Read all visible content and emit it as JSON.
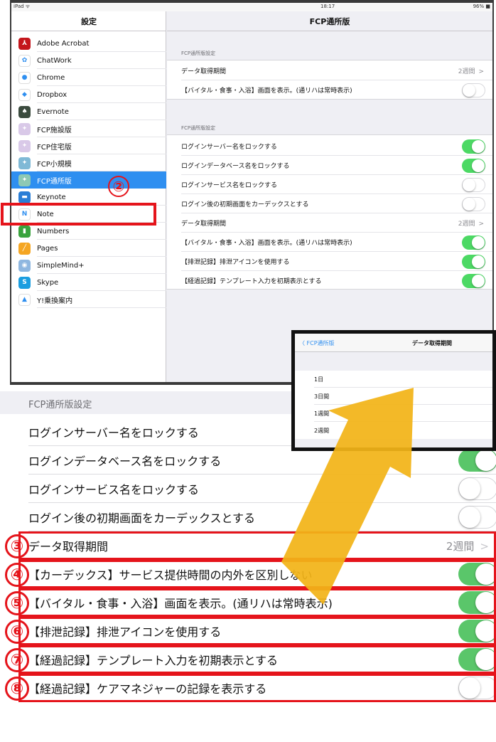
{
  "colors": {
    "accent": "#2f8ff0",
    "toggle_on": "#4cd964",
    "annotation_red": "#e5141b",
    "arrow": "#f2b418"
  },
  "status_bar": {
    "left": "iPad ᯤ",
    "time": "18:17",
    "battery": "96% ■"
  },
  "sidebar": {
    "title": "設定",
    "items": [
      {
        "label": "Adobe Acrobat",
        "icon": "acrobat-icon",
        "glyph": "⅄",
        "color": "#c4161c"
      },
      {
        "label": "ChatWork",
        "icon": "chatwork-icon",
        "glyph": "✿",
        "color": "#ffffff"
      },
      {
        "label": "Chrome",
        "icon": "chrome-icon",
        "glyph": "●",
        "color": "#ffffff"
      },
      {
        "label": "Dropbox",
        "icon": "dropbox-icon",
        "glyph": "◆",
        "color": "#ffffff"
      },
      {
        "label": "Evernote",
        "icon": "evernote-icon",
        "glyph": "♠",
        "color": "#3b4b3e"
      },
      {
        "label": "FCP施設版",
        "icon": "fcp-facility-icon",
        "glyph": "✦",
        "color": "#d9c9e8"
      },
      {
        "label": "FCP住宅版",
        "icon": "fcp-housing-icon",
        "glyph": "✦",
        "color": "#d9c9e8"
      },
      {
        "label": "FCP小規模",
        "icon": "fcp-small-icon",
        "glyph": "✦",
        "color": "#7fb9d6"
      },
      {
        "label": "FCP通所版",
        "icon": "fcp-daycare-icon",
        "glyph": "✦",
        "color": "#8dc9b4"
      },
      {
        "label": "Keynote",
        "icon": "keynote-icon",
        "glyph": "▬",
        "color": "#2a7ed6"
      },
      {
        "label": "Note",
        "icon": "note-icon",
        "glyph": "N",
        "color": "#ffffff"
      },
      {
        "label": "Numbers",
        "icon": "numbers-icon",
        "glyph": "▮",
        "color": "#3aa33d"
      },
      {
        "label": "Pages",
        "icon": "pages-icon",
        "glyph": "╱",
        "color": "#f5a623"
      },
      {
        "label": "SimpleMind+",
        "icon": "simplemind-icon",
        "glyph": "◉",
        "color": "#8fb7e0"
      },
      {
        "label": "Skype",
        "icon": "skype-icon",
        "glyph": "S",
        "color": "#1b9ee0"
      },
      {
        "label": "Y!乗換案内",
        "icon": "yahoo-transit-icon",
        "glyph": "▲",
        "color": "#ffffff"
      }
    ],
    "annotation": "②"
  },
  "detail": {
    "title": "FCP通所版",
    "group1": {
      "header": "FCP通所版設定",
      "rows": [
        {
          "label": "データ取得期間",
          "value": "2週間",
          "chevron": ">"
        },
        {
          "label": "【バイタル・食事・入浴】画面を表示。(通リハは常時表示)",
          "toggle": false
        }
      ]
    },
    "group2": {
      "header": "FCP通所版設定",
      "rows": [
        {
          "label": "ログインサーバー名をロックする",
          "toggle": true
        },
        {
          "label": "ログインデータベース名をロックする",
          "toggle": true
        },
        {
          "label": "ログインサービス名をロックする",
          "toggle": false
        },
        {
          "label": "ログイン後の初期画面をカーデックスとする",
          "toggle": false
        },
        {
          "label": "データ取得期間",
          "value": "2週間",
          "chevron": ">"
        },
        {
          "label": "【バイタル・食事・入浴】画面を表示。(通リハは常時表示)",
          "toggle": true
        },
        {
          "label": "【排泄記録】排泄アイコンを使用する",
          "toggle": true
        },
        {
          "label": "【経過記録】テンプレート入力を初期表示とする",
          "toggle": true
        }
      ]
    }
  },
  "popup": {
    "back": "〈 FCP通所版",
    "title": "データ取得期間",
    "options": [
      "1日",
      "3日間",
      "1週間",
      "2週間"
    ]
  },
  "zoom": {
    "header": "FCP通所版設定",
    "rows": [
      {
        "label": "ログインサーバー名をロックする",
        "toggle": true
      },
      {
        "label": "ログインデータベース名をロックする",
        "toggle": true
      },
      {
        "label": "ログインサービス名をロックする",
        "toggle": false
      },
      {
        "label": "ログイン後の初期画面をカーデックスとする",
        "toggle": false
      },
      {
        "label": "データ取得期間",
        "value": "2週間",
        "chevron": ">",
        "num": "③"
      },
      {
        "label": "【カーデックス】サービス提供時間の内外を区別しない",
        "toggle": true,
        "num": "④"
      },
      {
        "label": "【バイタル・食事・入浴】画面を表示。(通リハは常時表示)",
        "toggle": true,
        "num": "⑤"
      },
      {
        "label": "【排泄記録】排泄アイコンを使用する",
        "toggle": true,
        "num": "⑥"
      },
      {
        "label": "【経過記録】テンプレート入力を初期表示とする",
        "toggle": true,
        "num": "⑦"
      },
      {
        "label": "【経過記録】ケアマネジャーの記録を表示する",
        "toggle": false,
        "num": "⑧"
      }
    ]
  }
}
